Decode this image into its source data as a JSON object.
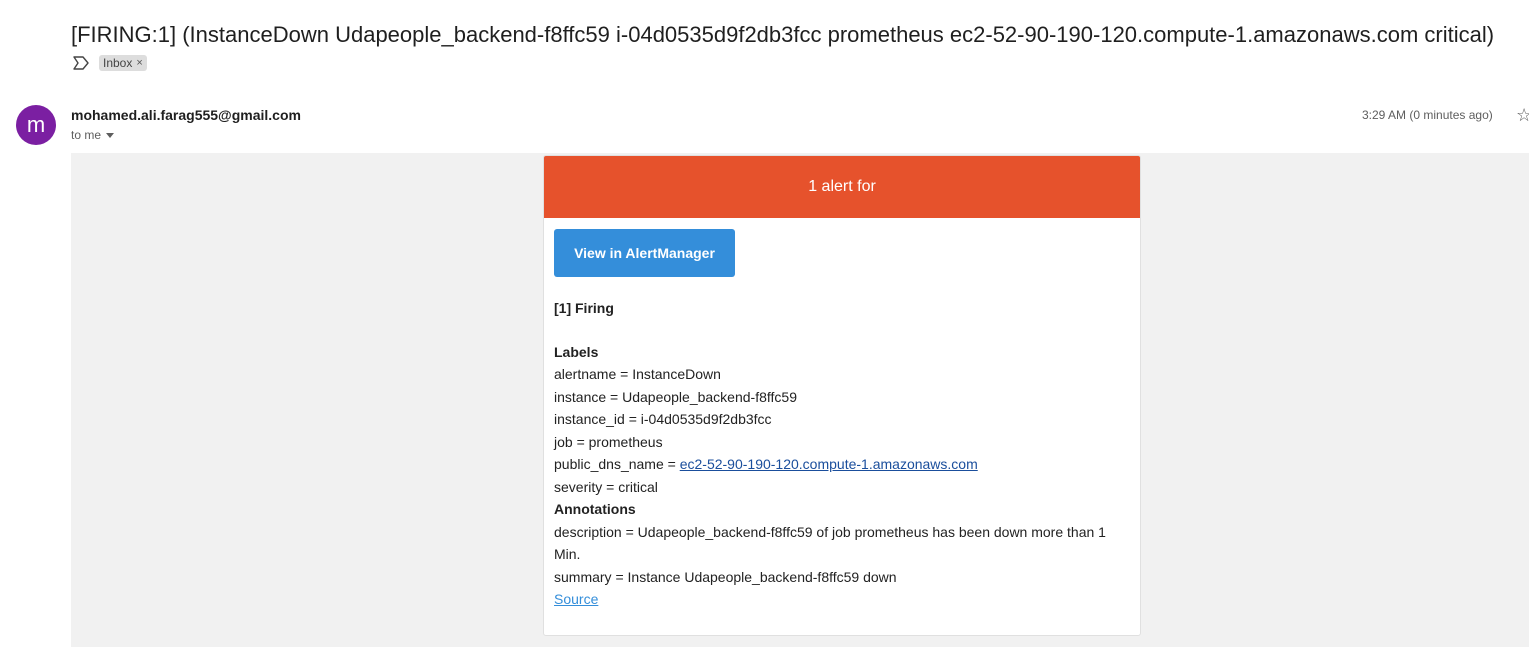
{
  "email": {
    "subject": "[FIRING:1] (InstanceDown Udapeople_backend-f8ffc59 i-04d0535d9f2db3fcc prometheus ec2-52-90-190-120.compute-1.amazonaws.com critical)",
    "label_chip": "Inbox",
    "label_chip_close": "×",
    "sender_initial": "m",
    "sender": "mohamed.ali.farag555@gmail.com",
    "recipient": "to me",
    "timestamp": "3:29 AM (0 minutes ago)",
    "icons": {
      "label": "important-label-icon",
      "recipient_toggle": "chevron-down-icon",
      "star": "star-icon"
    },
    "colors": {
      "avatar": "#7b1fa2",
      "alert_header": "#e6522c",
      "button": "#348eda"
    }
  },
  "alert": {
    "header": "1 alert for",
    "button_label": "View in AlertManager",
    "firing": "[1] Firing",
    "labels_title": "Labels",
    "labels": {
      "alertname": "alertname = InstanceDown",
      "instance": "instance = Udapeople_backend-f8ffc59",
      "instance_id": "instance_id = i-04d0535d9f2db3fcc",
      "job": "job = prometheus",
      "public_dns_prefix": "public_dns_name = ",
      "public_dns_link": "ec2-52-90-190-120.compute-1.amazonaws.com",
      "severity": "severity = critical"
    },
    "annotations_title": "Annotations",
    "annotations": {
      "description": "description = Udapeople_backend-f8ffc59 of job prometheus has been down more than 1 Min.",
      "summary": "summary = Instance Udapeople_backend-f8ffc59 down"
    },
    "source_link": "Source"
  }
}
